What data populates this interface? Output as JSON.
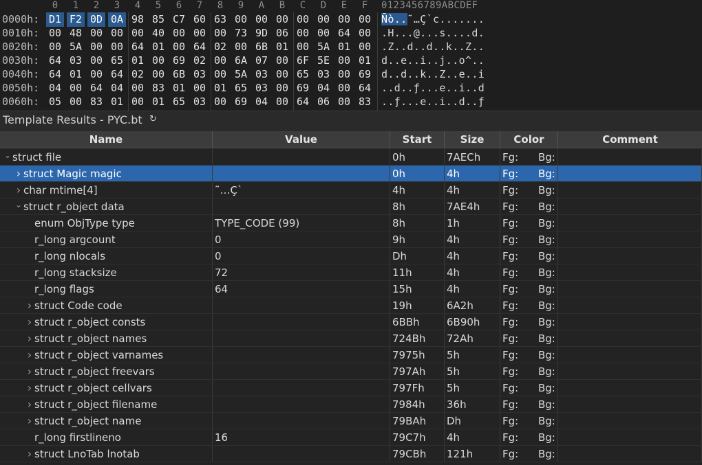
{
  "hex": {
    "columns": [
      "0",
      "1",
      "2",
      "3",
      "4",
      "5",
      "6",
      "7",
      "8",
      "9",
      "A",
      "B",
      "C",
      "D",
      "E",
      "F"
    ],
    "ascii_header": "0123456789ABCDEF",
    "rows": [
      {
        "offset": "0000h:",
        "bytes": [
          "D1",
          "F2",
          "0D",
          "0A",
          "98",
          "85",
          "C7",
          "60",
          "63",
          "00",
          "00",
          "00",
          "00",
          "00",
          "00",
          "00"
        ],
        "ascii": "Ñò..˜…Ç`c......."
      },
      {
        "offset": "0010h:",
        "bytes": [
          "00",
          "48",
          "00",
          "00",
          "00",
          "40",
          "00",
          "00",
          "00",
          "73",
          "9D",
          "06",
          "00",
          "00",
          "64",
          "00"
        ],
        "ascii": ".H...@...s....d."
      },
      {
        "offset": "0020h:",
        "bytes": [
          "00",
          "5A",
          "00",
          "00",
          "64",
          "01",
          "00",
          "64",
          "02",
          "00",
          "6B",
          "01",
          "00",
          "5A",
          "01",
          "00"
        ],
        "ascii": ".Z..d..d..k..Z.."
      },
      {
        "offset": "0030h:",
        "bytes": [
          "64",
          "03",
          "00",
          "65",
          "01",
          "00",
          "69",
          "02",
          "00",
          "6A",
          "07",
          "00",
          "6F",
          "5E",
          "00",
          "01"
        ],
        "ascii": "d..e..i..j..o^.."
      },
      {
        "offset": "0040h:",
        "bytes": [
          "64",
          "01",
          "00",
          "64",
          "02",
          "00",
          "6B",
          "03",
          "00",
          "5A",
          "03",
          "00",
          "65",
          "03",
          "00",
          "69"
        ],
        "ascii": "d..d..k..Z..e..i"
      },
      {
        "offset": "0050h:",
        "bytes": [
          "04",
          "00",
          "64",
          "04",
          "00",
          "83",
          "01",
          "00",
          "01",
          "65",
          "03",
          "00",
          "69",
          "04",
          "00",
          "64"
        ],
        "ascii": "..d..ƒ...e..i..d"
      },
      {
        "offset": "0060h:",
        "bytes": [
          "05",
          "00",
          "83",
          "01",
          "00",
          "01",
          "65",
          "03",
          "00",
          "69",
          "04",
          "00",
          "64",
          "06",
          "00",
          "83"
        ],
        "ascii": "..ƒ...e..i..d..ƒ"
      }
    ]
  },
  "template_results": {
    "title": "Template Results - PYC.bt",
    "refresh_icon": "↻",
    "headers": {
      "name": "Name",
      "value": "Value",
      "start": "Start",
      "size": "Size",
      "color": "Color",
      "comment": "Comment"
    },
    "rows": [
      {
        "indent": 0,
        "arrow": "v",
        "name": "struct file",
        "value": "",
        "start": "0h",
        "size": "7AECh",
        "fg": "Fg:",
        "bg": "Bg:",
        "comment": ""
      },
      {
        "indent": 1,
        "arrow": ">",
        "name": "struct Magic magic",
        "value": "",
        "start": "0h",
        "size": "4h",
        "fg": "Fg:",
        "bg": "Bg:",
        "comment": "",
        "selected": true
      },
      {
        "indent": 1,
        "arrow": ">",
        "name": "char mtime[4]",
        "value": "˜…Ç`",
        "start": "4h",
        "size": "4h",
        "fg": "Fg:",
        "bg": "Bg:",
        "comment": ""
      },
      {
        "indent": 1,
        "arrow": "v",
        "name": "struct r_object data",
        "value": "",
        "start": "8h",
        "size": "7AE4h",
        "fg": "Fg:",
        "bg": "Bg:",
        "comment": ""
      },
      {
        "indent": 2,
        "arrow": "",
        "name": "enum ObjType type",
        "value": "TYPE_CODE (99)",
        "start": "8h",
        "size": "1h",
        "fg": "Fg:",
        "bg": "Bg:",
        "comment": ""
      },
      {
        "indent": 2,
        "arrow": "",
        "name": "r_long argcount",
        "value": "0",
        "start": "9h",
        "size": "4h",
        "fg": "Fg:",
        "bg": "Bg:",
        "comment": ""
      },
      {
        "indent": 2,
        "arrow": "",
        "name": "r_long nlocals",
        "value": "0",
        "start": "Dh",
        "size": "4h",
        "fg": "Fg:",
        "bg": "Bg:",
        "comment": ""
      },
      {
        "indent": 2,
        "arrow": "",
        "name": "r_long stacksize",
        "value": "72",
        "start": "11h",
        "size": "4h",
        "fg": "Fg:",
        "bg": "Bg:",
        "comment": ""
      },
      {
        "indent": 2,
        "arrow": "",
        "name": "r_long flags",
        "value": "64",
        "start": "15h",
        "size": "4h",
        "fg": "Fg:",
        "bg": "Bg:",
        "comment": ""
      },
      {
        "indent": 2,
        "arrow": ">",
        "name": "struct Code code",
        "value": "",
        "start": "19h",
        "size": "6A2h",
        "fg": "Fg:",
        "bg": "Bg:",
        "comment": ""
      },
      {
        "indent": 2,
        "arrow": ">",
        "name": "struct r_object consts",
        "value": "",
        "start": "6BBh",
        "size": "6B90h",
        "fg": "Fg:",
        "bg": "Bg:",
        "comment": ""
      },
      {
        "indent": 2,
        "arrow": ">",
        "name": "struct r_object names",
        "value": "",
        "start": "724Bh",
        "size": "72Ah",
        "fg": "Fg:",
        "bg": "Bg:",
        "comment": ""
      },
      {
        "indent": 2,
        "arrow": ">",
        "name": "struct r_object varnames",
        "value": "",
        "start": "7975h",
        "size": "5h",
        "fg": "Fg:",
        "bg": "Bg:",
        "comment": ""
      },
      {
        "indent": 2,
        "arrow": ">",
        "name": "struct r_object freevars",
        "value": "",
        "start": "797Ah",
        "size": "5h",
        "fg": "Fg:",
        "bg": "Bg:",
        "comment": ""
      },
      {
        "indent": 2,
        "arrow": ">",
        "name": "struct r_object cellvars",
        "value": "",
        "start": "797Fh",
        "size": "5h",
        "fg": "Fg:",
        "bg": "Bg:",
        "comment": ""
      },
      {
        "indent": 2,
        "arrow": ">",
        "name": "struct r_object filename",
        "value": "",
        "start": "7984h",
        "size": "36h",
        "fg": "Fg:",
        "bg": "Bg:",
        "comment": ""
      },
      {
        "indent": 2,
        "arrow": ">",
        "name": "struct r_object name",
        "value": "",
        "start": "79BAh",
        "size": "Dh",
        "fg": "Fg:",
        "bg": "Bg:",
        "comment": ""
      },
      {
        "indent": 2,
        "arrow": "",
        "name": "r_long firstlineno",
        "value": "16",
        "start": "79C7h",
        "size": "4h",
        "fg": "Fg:",
        "bg": "Bg:",
        "comment": ""
      },
      {
        "indent": 2,
        "arrow": ">",
        "name": "struct LnoTab lnotab",
        "value": "",
        "start": "79CBh",
        "size": "121h",
        "fg": "Fg:",
        "bg": "Bg:",
        "comment": ""
      }
    ]
  },
  "colors": {
    "selection": "#2c67ad",
    "background": "#232323",
    "header_bg": "#3c3c3c"
  }
}
